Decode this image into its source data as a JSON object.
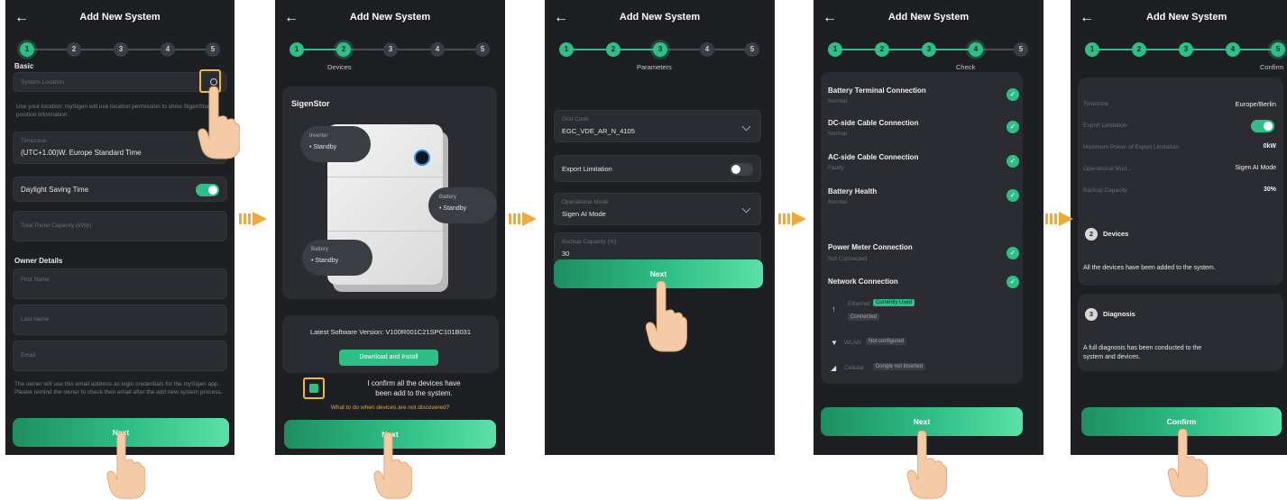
{
  "app_title": "Add New System",
  "colors": {
    "accent": "#2fbf86",
    "screen_bg": "#1e1f23",
    "card_bg": "#2a2c31",
    "warning": "#f0b93b",
    "arrow": "#f0a93b",
    "hand": "#f4cba6"
  },
  "steps": [
    "1",
    "2",
    "3",
    "4",
    "5"
  ],
  "screen1": {
    "section_basic": "Basic",
    "system_location_placeholder": "System Location",
    "location_hint": "Use your location: mySigen will use location permission to show SigenStor position information",
    "timezone_label": "Timezone",
    "timezone_value": "(UTC+1.00)W. Europe Standard Time",
    "daylight_label": "Daylight Saving Time",
    "panel_capacity_placeholder": "Total Panel Capacity (kWp)",
    "section_owner": "Owner Details",
    "first_name_placeholder": "First Name",
    "last_name_placeholder": "Last Name",
    "email_placeholder": "Email",
    "owner_note": "The owner will use this email address as login credentials for the mySigen app. Please remind the owner to check their email after the add new system process.",
    "next_label": "Next"
  },
  "screen2": {
    "step_label": "Devices",
    "device_title": "SigenStor",
    "inverter_label": "Inverter",
    "inverter_status": "Standby",
    "battery_right_label": "Battery",
    "battery_right_status": "Standby",
    "battery_left_label": "Battery",
    "battery_left_status": "Standby",
    "software_version": "Latest Software Version: V100R001C21SPC101B031",
    "download_label": "Download and Install",
    "confirm_text_1": "I confirm all the devices have",
    "confirm_text_2": "been add to the system.",
    "discover_link": "What to do when devices are not discovered?",
    "next_label": "Next"
  },
  "screen3": {
    "step_label": "Parameters",
    "grid_code_label": "Grid Code",
    "grid_code_value": "EGC_VDE_AR_N_4105",
    "export_limitation_label": "Export Limitation",
    "operational_mode_label": "Operational Mode",
    "operational_mode_value": "Sigen AI Mode",
    "backup_capacity_label": "Backup Capacity (%)",
    "backup_capacity_value": "30",
    "next_label": "Next"
  },
  "screen4": {
    "step_label": "Check",
    "checks": [
      {
        "title": "Battery Terminal Connection",
        "status": "Normal"
      },
      {
        "title": "DC-side Cable Connection",
        "status": "Normal"
      },
      {
        "title": "AC-side Cable Connection",
        "status": "Faulty"
      },
      {
        "title": "Battery Health",
        "status": "Normal"
      }
    ],
    "power_meter_title": "Power Meter Connection",
    "power_meter_status": "Not Connected",
    "network_title": "Network Connection",
    "ethernet_label": "Ethernet",
    "ethernet_badge": "Currently Used",
    "ethernet_status": "Connected",
    "wlan_label": "WLAN",
    "wlan_status": "Not configured",
    "cellular_label": "Cellular",
    "cellular_status": "Dongle not inserted",
    "next_label": "Next"
  },
  "screen5": {
    "step_label": "Confirm",
    "summary": [
      {
        "label": "Timezone",
        "value": "Europe/Berlin"
      },
      {
        "label": "Export Limitation",
        "value": ""
      },
      {
        "label": "Maximum Power of Export Limitation",
        "value": "0kW"
      },
      {
        "label": "Operational Mod...",
        "value": "Sigen AI Mode"
      },
      {
        "label": "Backup Capacity",
        "value": "30%"
      }
    ],
    "devices_num": "2",
    "devices_title": "Devices",
    "devices_text": "All the devices have been added to the system.",
    "diagnosis_num": "3",
    "diagnosis_title": "Diagnosis",
    "diagnosis_text_1": "A full diagnosis has been conducted to the",
    "diagnosis_text_2": "system and devices.",
    "confirm_label": "Confirm"
  }
}
